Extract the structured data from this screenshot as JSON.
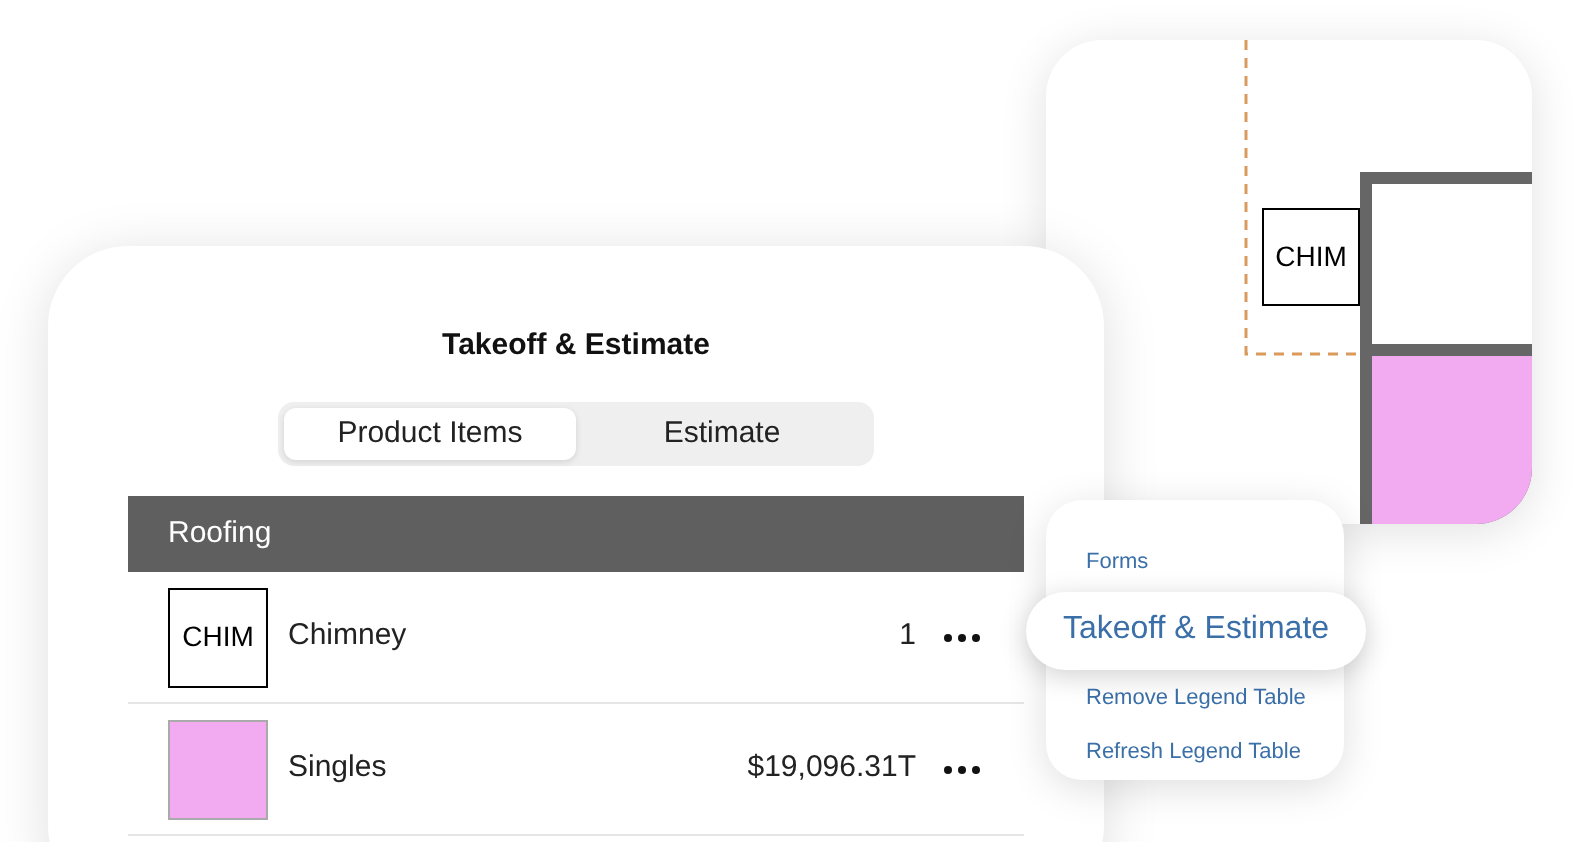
{
  "plan": {
    "label": "CHIM"
  },
  "panel": {
    "title": "Takeoff & Estimate",
    "tabs": [
      {
        "label": "Product Items",
        "selected": true
      },
      {
        "label": "Estimate",
        "selected": false
      }
    ],
    "group": "Roofing",
    "rows": [
      {
        "kind": "label",
        "label": "CHIM",
        "name": "Chimney",
        "value": "1"
      },
      {
        "kind": "swatch",
        "color": "#f2aaf0",
        "name": "Singles",
        "value": "$19,096.31T"
      }
    ]
  },
  "menu": {
    "items": [
      {
        "label": "Forms",
        "selected": false
      },
      {
        "label": "Takeoff & Estimate",
        "selected": true
      },
      {
        "label": "Remove Legend Table",
        "selected": false
      },
      {
        "label": "Refresh Legend Table",
        "selected": false
      }
    ]
  }
}
